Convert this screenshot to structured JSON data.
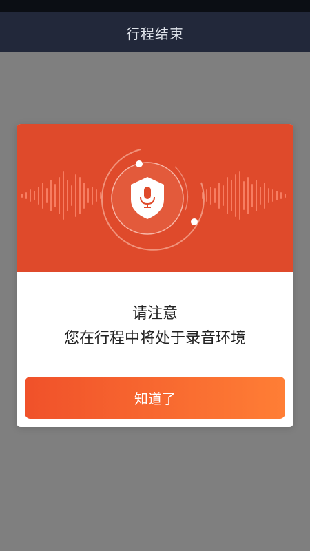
{
  "nav": {
    "title": "行程结束"
  },
  "dialog": {
    "message_line1": "请注意",
    "message_line2": "您在行程中将处于录音环境",
    "confirm_label": "知道了",
    "hero_icon": "shield-microphone-icon"
  },
  "colors": {
    "nav_bg": "#22283a",
    "overlay": "#7f7f7f",
    "hero_bg": "#df4a2b",
    "button_start": "#f0512a",
    "button_end": "#ff7e35"
  }
}
